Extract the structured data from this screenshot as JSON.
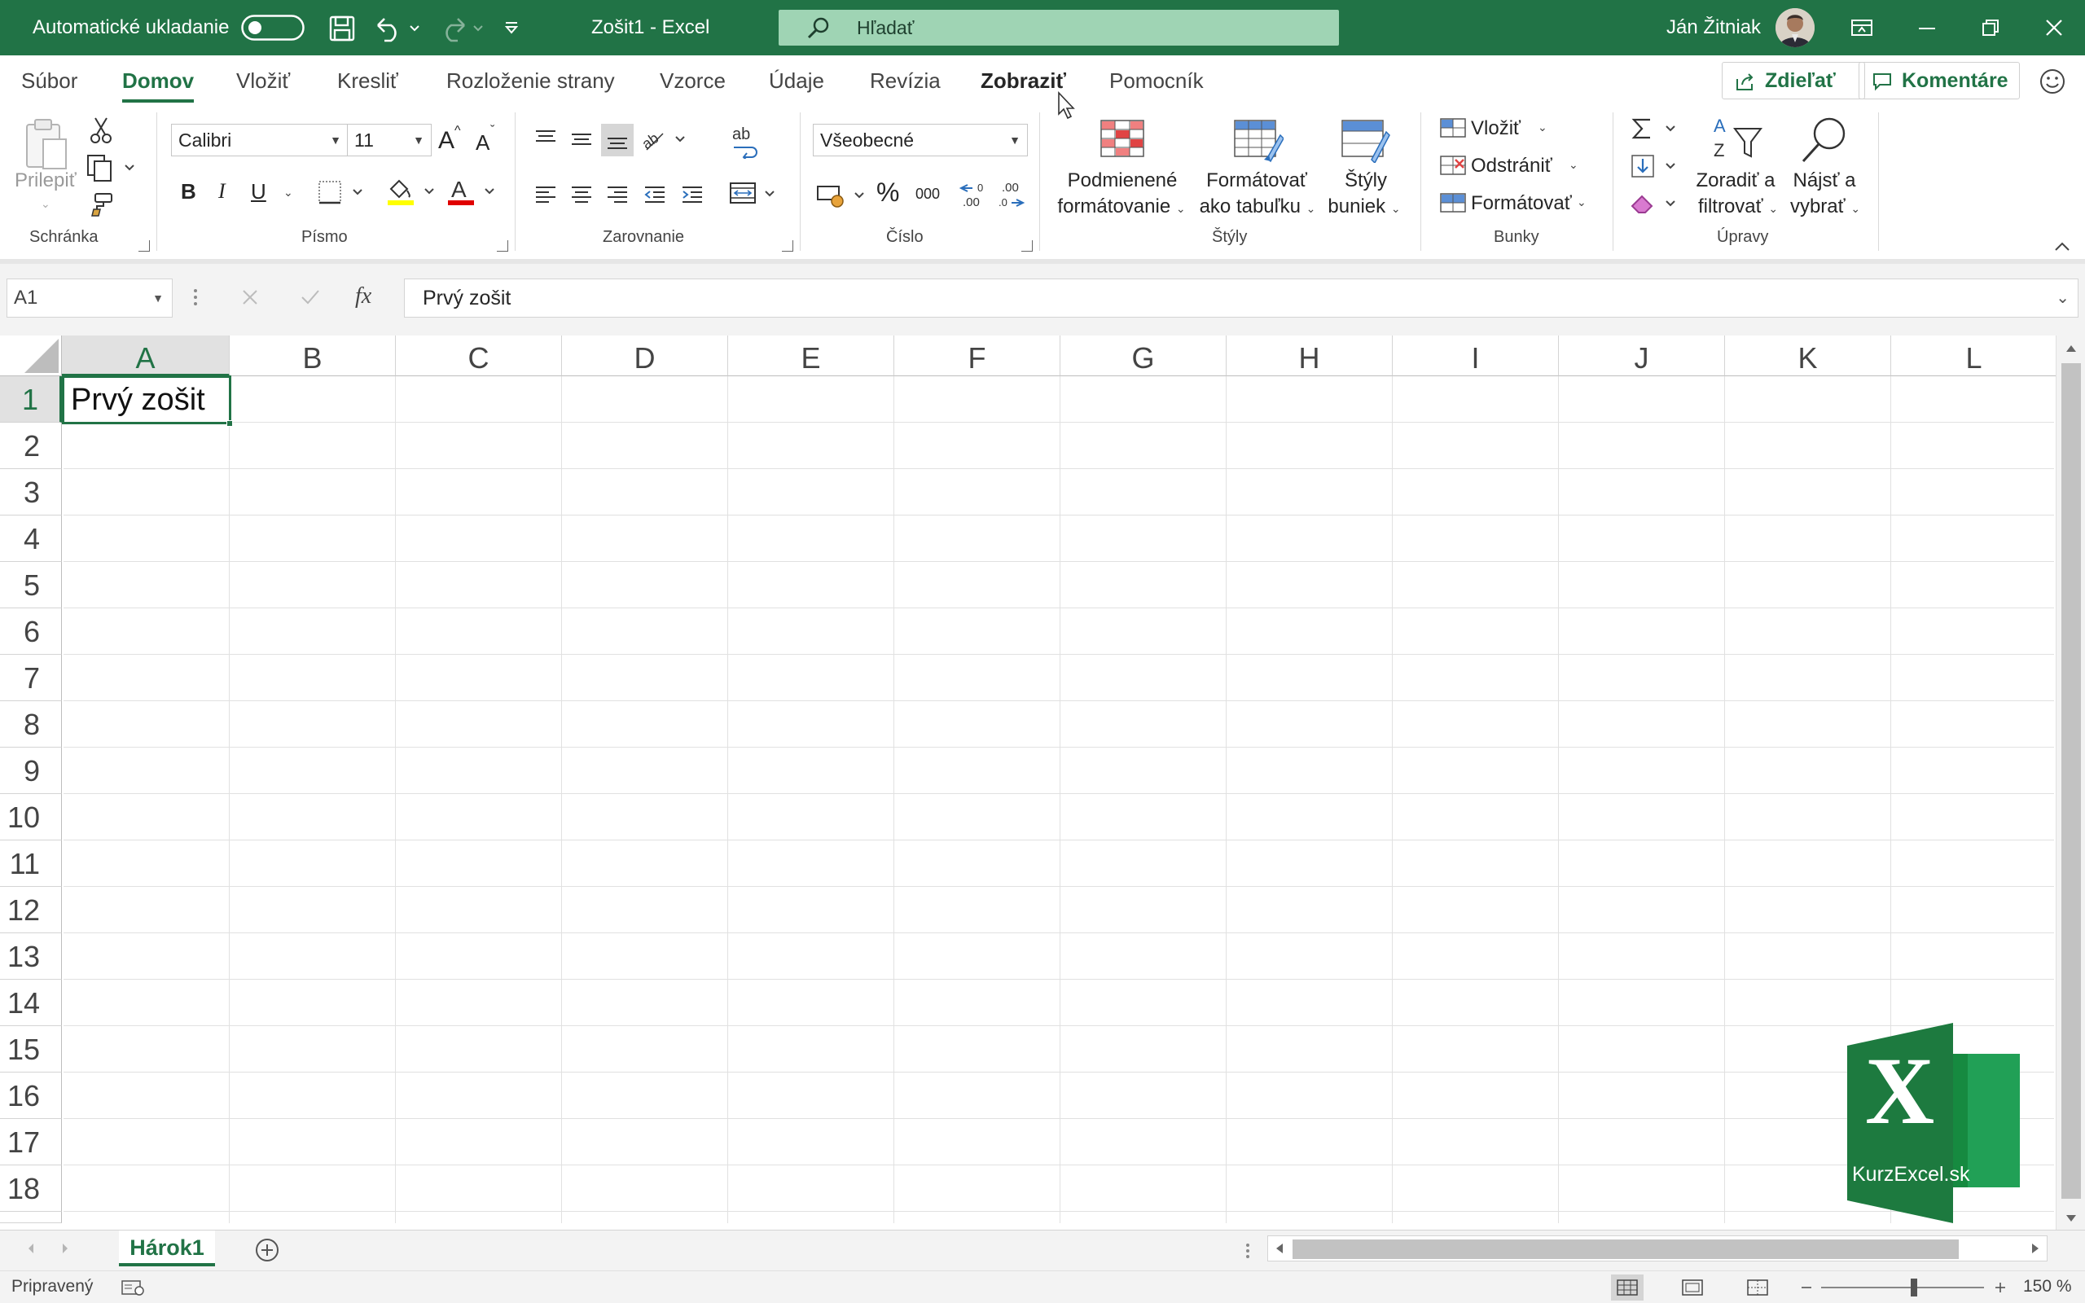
{
  "titlebar": {
    "autosave_label": "Automatické ukladanie",
    "document_title": "Zošit1  -  Excel",
    "search_placeholder": "Hľadať",
    "user_name": "Ján Žitniak"
  },
  "tabs": [
    {
      "label": "Súbor"
    },
    {
      "label": "Domov"
    },
    {
      "label": "Vložiť"
    },
    {
      "label": "Kresliť"
    },
    {
      "label": "Rozloženie strany"
    },
    {
      "label": "Vzorce"
    },
    {
      "label": "Údaje"
    },
    {
      "label": "Revízia"
    },
    {
      "label": "Zobraziť"
    },
    {
      "label": "Pomocník"
    }
  ],
  "share_label": "Zdieľať",
  "comments_label": "Komentáre",
  "ribbon": {
    "clipboard": {
      "paste_label": "Prilepiť",
      "group_label": "Schránka"
    },
    "font": {
      "font_name": "Calibri",
      "font_size": "11",
      "bold": "B",
      "italic": "I",
      "underline": "U",
      "grow": "A",
      "shrink": "A",
      "font_color_glyph": "A",
      "group_label": "Písmo"
    },
    "alignment": {
      "group_label": "Zarovnanie",
      "wrap_glyph": "ab"
    },
    "number": {
      "format": "Všeobecné",
      "percent": "%",
      "thousands": "000",
      "group_label": "Číslo"
    },
    "styles": {
      "conditional_line1": "Podmienené",
      "conditional_line2": "formátovanie",
      "format_table_line1": "Formátovať",
      "format_table_line2": "ako tabuľku",
      "cell_styles_line1": "Štýly",
      "cell_styles_line2": "buniek",
      "group_label": "Štýly"
    },
    "cells": {
      "insert": "Vložiť",
      "delete": "Odstrániť",
      "format": "Formátovať",
      "group_label": "Bunky"
    },
    "editing": {
      "sort_line1": "Zoradiť a",
      "sort_line2": "filtrovať",
      "find_line1": "Nájsť a",
      "find_line2": "vybrať",
      "group_label": "Úpravy"
    }
  },
  "formula_bar": {
    "name_box": "A1",
    "fx": "fx",
    "formula": "Prvý zošit"
  },
  "grid": {
    "columns": [
      "A",
      "B",
      "C",
      "D",
      "E",
      "F",
      "G",
      "H",
      "I",
      "J",
      "K",
      "L"
    ],
    "rows": [
      "1",
      "2",
      "3",
      "4",
      "5",
      "6",
      "7",
      "8",
      "9",
      "10",
      "11",
      "12",
      "13",
      "14",
      "15",
      "16",
      "17",
      "18"
    ],
    "selected_cell": "A1",
    "cell_a1": "Prvý zošit"
  },
  "sheets": [
    {
      "label": "Hárok1"
    }
  ],
  "status": {
    "ready": "Pripravený",
    "zoom": "150 %"
  },
  "logo": {
    "letter": "X",
    "text": "KurzExcel.sk"
  },
  "colors": {
    "accent": "#217346",
    "search_bg": "#9fd4b4",
    "logo_dark": "#1d7a3f",
    "logo_light": "#21a056"
  },
  "icons": [
    "toggle-icon",
    "save-icon",
    "undo-icon",
    "redo-icon",
    "customize-qat-icon",
    "search-icon",
    "avatar",
    "ribbon-display-icon",
    "minimize-icon",
    "restore-icon",
    "close-icon",
    "share-icon",
    "comment-icon",
    "smiley-icon"
  ]
}
